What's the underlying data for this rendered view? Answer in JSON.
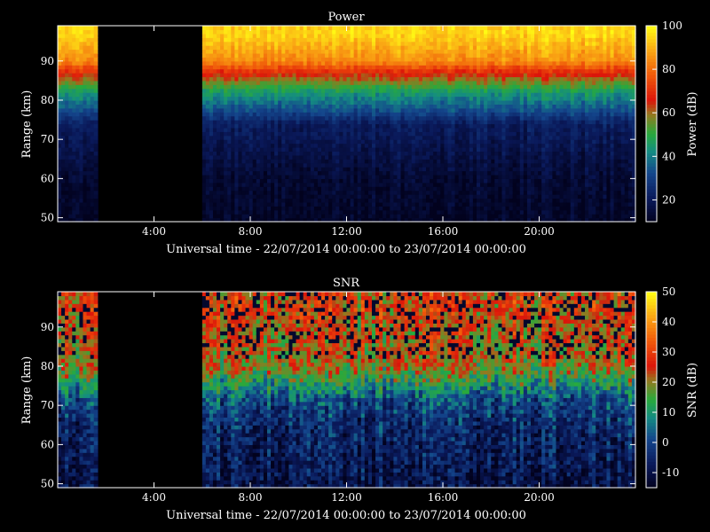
{
  "xlabel": "Universal time - 22/07/2014 00:00:00 to 23/07/2014 00:00:00",
  "ylabel": "Range (km)",
  "chart_data": [
    {
      "type": "heatmap",
      "title": "Power",
      "xlabel": "Universal time - 22/07/2014 00:00:00 to 23/07/2014 00:00:00",
      "ylabel": "Range (km)",
      "xlim": [
        0,
        24
      ],
      "ylim": [
        49,
        99
      ],
      "x_ticks": [
        "4:00",
        "8:00",
        "12:00",
        "16:00",
        "20:00"
      ],
      "y_ticks": [
        "50",
        "60",
        "70",
        "80",
        "90"
      ],
      "colorbar": {
        "label": "Power (dB)",
        "range": [
          10,
          100
        ],
        "ticks": [
          "20",
          "40",
          "60",
          "80",
          "100"
        ]
      },
      "gap_hours": [
        1.7,
        6.0
      ],
      "profile_levels_by_range_km": [
        {
          "range_km": 97,
          "level": 95
        },
        {
          "range_km": 90,
          "level": 85
        },
        {
          "range_km": 87,
          "level": 68
        },
        {
          "range_km": 82,
          "level": 45
        },
        {
          "range_km": 78,
          "level": 35
        },
        {
          "range_km": 74,
          "level": 22
        },
        {
          "range_km": 60,
          "level": 14
        },
        {
          "range_km": 50,
          "level": 12
        }
      ]
    },
    {
      "type": "heatmap",
      "title": "SNR",
      "xlabel": "Universal time - 22/07/2014 00:00:00 to 23/07/2014 00:00:00",
      "ylabel": "Range (km)",
      "xlim": [
        0,
        24
      ],
      "ylim": [
        49,
        99
      ],
      "x_ticks": [
        "4:00",
        "8:00",
        "12:00",
        "16:00",
        "20:00"
      ],
      "y_ticks": [
        "50",
        "60",
        "70",
        "80",
        "90"
      ],
      "colorbar": {
        "label": "SNR (dB)",
        "range": [
          -15,
          50
        ],
        "ticks": [
          "-10",
          "0",
          "10",
          "20",
          "30",
          "40",
          "50"
        ]
      },
      "gap_hours": [
        1.7,
        6.0
      ],
      "profile_levels_by_range_km": [
        {
          "range_km": 95,
          "level": 25
        },
        {
          "range_km": 85,
          "level": 22
        },
        {
          "range_km": 80,
          "level": 20
        },
        {
          "range_km": 76,
          "level": 12
        },
        {
          "range_km": 72,
          "level": 2
        },
        {
          "range_km": 65,
          "level": -5
        },
        {
          "range_km": 55,
          "level": -8
        },
        {
          "range_km": 50,
          "level": -10
        }
      ]
    }
  ]
}
